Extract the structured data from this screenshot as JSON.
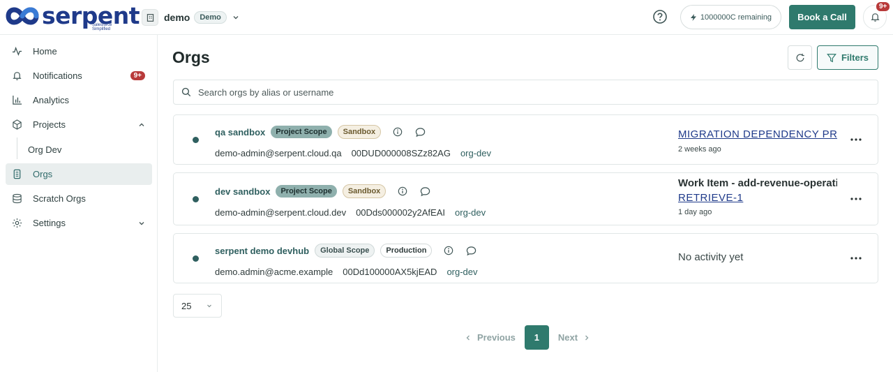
{
  "brand": {
    "name": "Serpent",
    "logo_text": "serpent",
    "tagline": "Salesforce Simplified"
  },
  "header": {
    "org_name": "demo",
    "org_badge": "Demo",
    "credits": "1000000C remaining",
    "book_call": "Book a Call",
    "notif_badge": "9+"
  },
  "sidebar": {
    "items": [
      {
        "label": "Home",
        "icon": "activity-icon"
      },
      {
        "label": "Notifications",
        "icon": "bell-icon",
        "badge": "9+"
      },
      {
        "label": "Analytics",
        "icon": "bar-chart-icon"
      },
      {
        "label": "Projects",
        "icon": "box-icon"
      },
      {
        "label": "Org Dev"
      },
      {
        "label": "Orgs",
        "icon": "database-icon"
      },
      {
        "label": "Scratch Orgs",
        "icon": "stack-icon"
      },
      {
        "label": "Settings",
        "icon": "gear-icon"
      }
    ]
  },
  "main": {
    "title": "Orgs",
    "filters_label": "Filters",
    "search_placeholder": "Search orgs by alias or username"
  },
  "orgs": [
    {
      "alias": "qa sandbox",
      "scope": "Project Scope",
      "type": "Sandbox",
      "username": "demo-admin@serpent.cloud.qa",
      "org_id": "00DUD000008SZz82AG",
      "env": "org-dev",
      "activity_title": "MIGRATION DEPENDENCY PREFLIGHT",
      "activity_time": "2 weeks ago"
    },
    {
      "alias": "dev sandbox",
      "scope": "Project Scope",
      "type": "Sandbox",
      "username": "demo-admin@serpent.cloud.dev",
      "org_id": "00Dds000002y2AfEAI",
      "env": "org-dev",
      "activity_heading": "Work Item - add-revenue-operations",
      "activity_link": "RETRIEVE-1",
      "activity_time": "1 day ago"
    },
    {
      "alias": "serpent demo devhub",
      "scope": "Global Scope",
      "type": "Production",
      "username": "demo.admin@acme.example",
      "org_id": "00Dd100000AX5kjEAD",
      "env": "org-dev",
      "activity_none": "No activity yet"
    }
  ],
  "pagination": {
    "per_page": "25",
    "previous": "Previous",
    "current": "1",
    "next": "Next"
  },
  "colors": {
    "accent": "#2f7a6d",
    "brand": "#1f3a8a",
    "badge": "#b83a3a",
    "active_nav": "#e9eeee"
  }
}
